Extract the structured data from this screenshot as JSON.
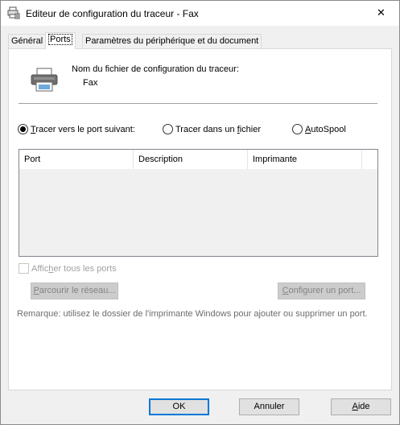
{
  "window": {
    "title": "Editeur de configuration du traceur - Fax",
    "close_glyph": "✕"
  },
  "tabs": [
    {
      "label": "Général",
      "active": false
    },
    {
      "label": "Ports",
      "active": true
    },
    {
      "label": "Paramètres du périphérique et du document",
      "active": false
    }
  ],
  "header": {
    "icon": "printer-icon",
    "config_label": "Nom du fichier de configuration du traceur:",
    "config_value": "Fax"
  },
  "radios": [
    {
      "label_pre": "",
      "label_u": "T",
      "label_post": "racer vers le port suivant:",
      "checked": true
    },
    {
      "label_pre": "Tracer dans un ",
      "label_u": "f",
      "label_post": "ichier",
      "checked": false
    },
    {
      "label_pre": "",
      "label_u": "A",
      "label_post": "utoSpool",
      "checked": false
    }
  ],
  "ports_table": {
    "columns": [
      "Port",
      "Description",
      "Imprimante"
    ],
    "rows": []
  },
  "show_all_ports": {
    "label_pre": "Affic",
    "label_u": "h",
    "label_post": "er tous les ports",
    "checked": false,
    "enabled": false
  },
  "buttons": {
    "browse_pre": "",
    "browse_u": "P",
    "browse_post": "arcourir le réseau...",
    "configure_pre": "",
    "configure_u": "C",
    "configure_post": "onfigurer un port...",
    "ok": "OK",
    "cancel": "Annuler",
    "help_pre": "",
    "help_u": "A",
    "help_post": "ide"
  },
  "remark": "Remarque: utilisez le dossier de l'imprimante Windows pour ajouter ou supprimer un port.",
  "colors": {
    "default_button_border": "#0078d7",
    "disabled_text": "#838383"
  }
}
